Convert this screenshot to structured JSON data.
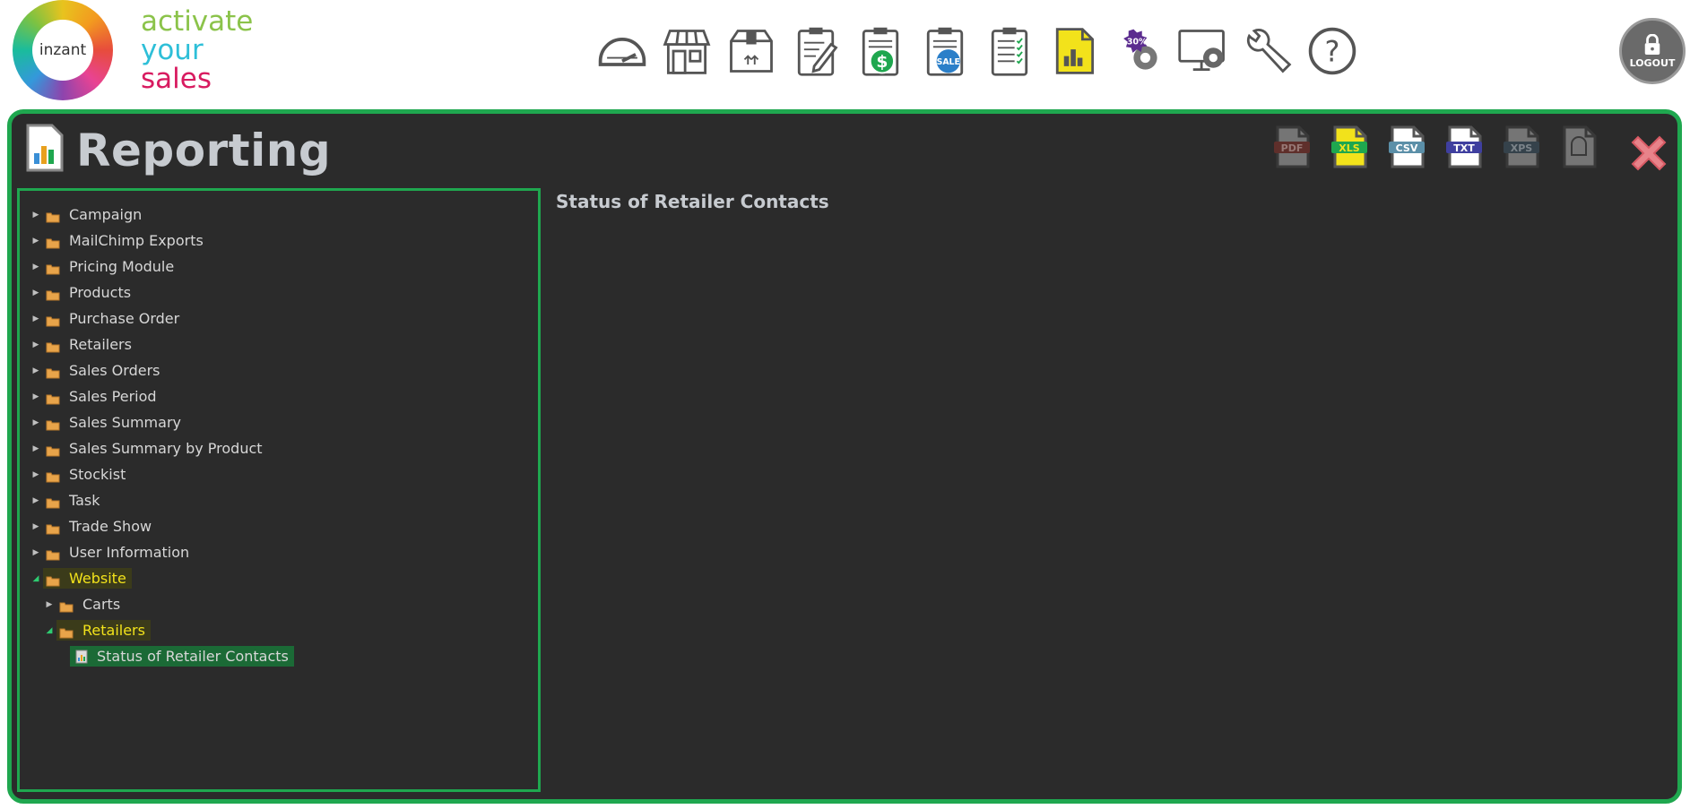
{
  "brand": {
    "logo_text": "inzant",
    "tagline": [
      "activate",
      "your",
      "sales"
    ]
  },
  "nav": [
    {
      "name": "dashboard-icon"
    },
    {
      "name": "store-icon"
    },
    {
      "name": "package-icon"
    },
    {
      "name": "clipboard-edit-icon"
    },
    {
      "name": "clipboard-dollar-icon"
    },
    {
      "name": "clipboard-sale-icon",
      "badge": "SALE"
    },
    {
      "name": "clipboard-checklist-icon"
    },
    {
      "name": "reporting-icon"
    },
    {
      "name": "discount-settings-icon",
      "badge": "-30%"
    },
    {
      "name": "monitor-settings-icon"
    },
    {
      "name": "wrench-icon"
    },
    {
      "name": "help-icon"
    }
  ],
  "logout_label": "LOGOUT",
  "panel": {
    "title": "Reporting",
    "exports": [
      {
        "label": "PDF",
        "enabled": false,
        "color": "#c0392b"
      },
      {
        "label": "XLS",
        "enabled": true,
        "color": "#1fa74f",
        "active": true
      },
      {
        "label": "CSV",
        "enabled": true,
        "color": "#5b8fa8"
      },
      {
        "label": "TXT",
        "enabled": true,
        "color": "#3f3f9f"
      },
      {
        "label": "XPS",
        "enabled": false,
        "color": "#4a6e88"
      },
      {
        "label": "",
        "enabled": false,
        "color": "#777777"
      }
    ]
  },
  "tree": [
    {
      "label": "Campaign",
      "level": 0,
      "state": "closed"
    },
    {
      "label": "MailChimp Exports",
      "level": 0,
      "state": "closed"
    },
    {
      "label": "Pricing Module",
      "level": 0,
      "state": "closed"
    },
    {
      "label": "Products",
      "level": 0,
      "state": "closed"
    },
    {
      "label": "Purchase Order",
      "level": 0,
      "state": "closed"
    },
    {
      "label": "Retailers",
      "level": 0,
      "state": "closed"
    },
    {
      "label": "Sales Orders",
      "level": 0,
      "state": "closed"
    },
    {
      "label": "Sales Period",
      "level": 0,
      "state": "closed"
    },
    {
      "label": "Sales Summary",
      "level": 0,
      "state": "closed"
    },
    {
      "label": "Sales Summary by Product",
      "level": 0,
      "state": "closed"
    },
    {
      "label": "Stockist",
      "level": 0,
      "state": "closed"
    },
    {
      "label": "Task",
      "level": 0,
      "state": "closed"
    },
    {
      "label": "Trade Show",
      "level": 0,
      "state": "closed"
    },
    {
      "label": "User Information",
      "level": 0,
      "state": "closed"
    },
    {
      "label": "Website",
      "level": 0,
      "state": "open",
      "highlight": true
    },
    {
      "label": "Carts",
      "level": 1,
      "state": "closed"
    },
    {
      "label": "Retailers",
      "level": 1,
      "state": "open",
      "highlight": true
    },
    {
      "label": "Status of Retailer Contacts",
      "level": 2,
      "state": "leaf",
      "selected": true
    }
  ],
  "content": {
    "title": "Status of Retailer Contacts"
  }
}
